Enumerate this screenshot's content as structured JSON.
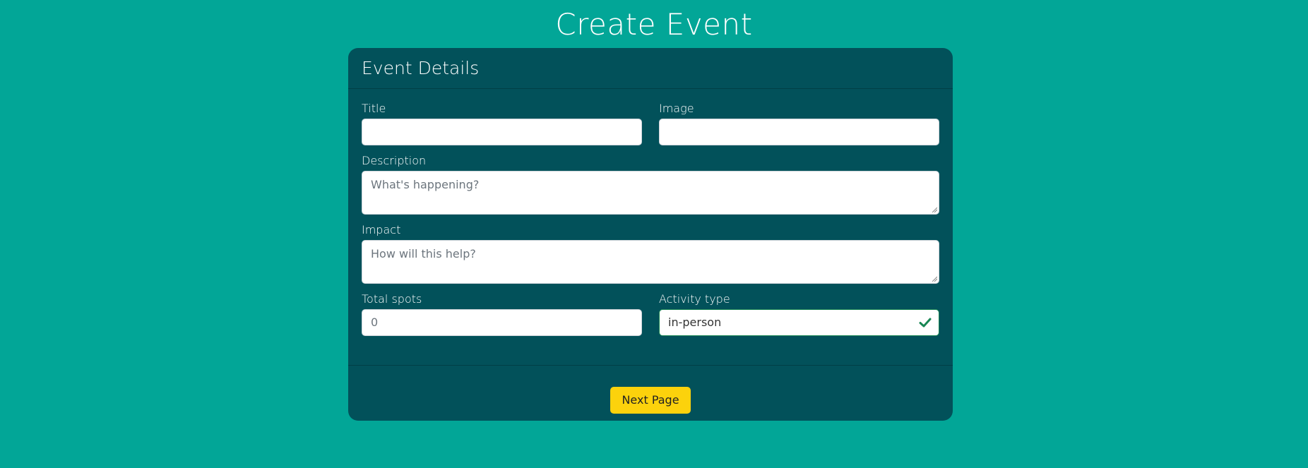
{
  "page": {
    "title": "Create Event"
  },
  "card": {
    "header": "Event Details",
    "fields": {
      "title": {
        "label": "Title",
        "value": ""
      },
      "image": {
        "label": "Image",
        "value": ""
      },
      "description": {
        "label": "Description",
        "placeholder": "What's happening?"
      },
      "impact": {
        "label": "Impact",
        "placeholder": "How will this help?"
      },
      "total_spots": {
        "label": "Total spots",
        "value": "0"
      },
      "activity_type": {
        "label": "Activity type",
        "value": "in-person",
        "valid_icon": "check-icon"
      }
    },
    "footer": {
      "next_label": "Next Page"
    }
  },
  "colors": {
    "background": "#02a697",
    "card": "#02515a",
    "button": "#fcd20c",
    "valid": "#198754"
  }
}
